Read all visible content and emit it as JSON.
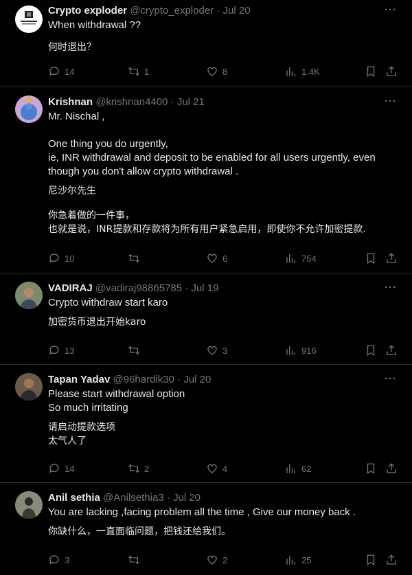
{
  "tweets": [
    {
      "name": "Crypto exploder",
      "handle": "@crypto_exploder",
      "date": "Jul 20",
      "lines_en": [
        "When withdrawal ??"
      ],
      "lines_zh": [
        "何时退出？"
      ],
      "replies": "14",
      "retweets": "1",
      "likes": "8",
      "views": "1.4K",
      "avatar": "logo-avatar"
    },
    {
      "name": "Krishnan",
      "handle": "@krishnan4400",
      "date": "Jul 21",
      "lines_en": [
        "Mr. Nischal ,",
        "",
        "One thing you do urgently,",
        "ie, INR withdrawal and deposit to be enabled for all users urgently, even though you don't allow crypto withdrawal ."
      ],
      "lines_zh": [
        "尼沙尔先生",
        "",
        "你急着做的一件事，",
        "也就是说，INR提款和存款将为所有用户紧急启用，即使你不允许加密提款."
      ],
      "replies": "10",
      "retweets": "",
      "likes": "6",
      "views": "754",
      "avatar": "deity-avatar"
    },
    {
      "name": "VADIRAJ",
      "handle": "@vadiraj98865785",
      "date": "Jul 19",
      "lines_en": [
        "Crypto withdraw  start karo"
      ],
      "lines_zh": [
        "加密货币退出开始karo"
      ],
      "replies": "13",
      "retweets": "",
      "likes": "3",
      "views": "916",
      "avatar": "person-avatar"
    },
    {
      "name": "Tapan Yadav",
      "handle": "@96hardik30",
      "date": "Jul 20",
      "lines_en": [
        "Please start withdrawal option",
        "So much irritating"
      ],
      "lines_zh": [
        "请启动提款选项",
        "太气人了"
      ],
      "replies": "14",
      "retweets": "2",
      "likes": "4",
      "views": "62",
      "avatar": "person-avatar"
    },
    {
      "name": "Anil sethia",
      "handle": "@Anilsethia3",
      "date": "Jul 20",
      "lines_en": [
        "You are lacking ,facing problem all the time , Give our money back ."
      ],
      "lines_zh": [
        "你缺什么，一直面临问题，把钱还给我们。"
      ],
      "replies": "3",
      "retweets": "",
      "likes": "2",
      "views": "25",
      "avatar": "person-avatar"
    }
  ],
  "more_label": "···"
}
